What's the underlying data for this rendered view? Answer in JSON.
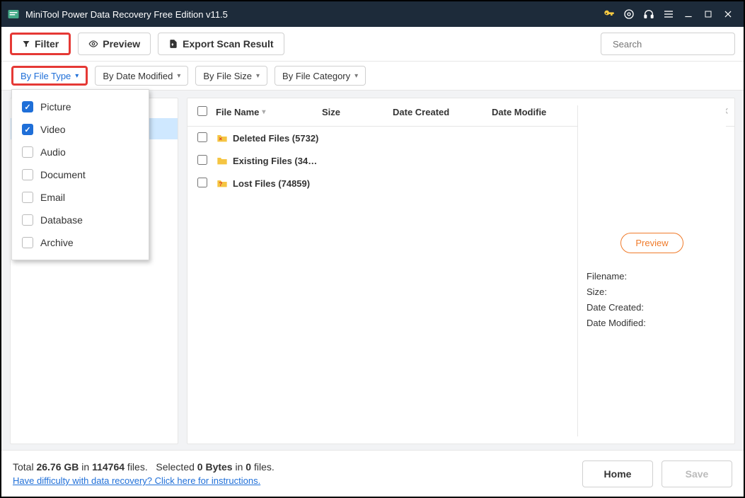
{
  "titlebar": {
    "title": "MiniTool Power Data Recovery Free Edition v11.5"
  },
  "toolbar": {
    "filter": "Filter",
    "preview": "Preview",
    "export": "Export Scan Result",
    "search_placeholder": "Search"
  },
  "filters": {
    "by_file_type": "By File Type",
    "by_date_modified": "By Date Modified",
    "by_file_size": "By File Size",
    "by_file_category": "By File Category"
  },
  "dropdown": {
    "items": [
      {
        "label": "Picture",
        "checked": true
      },
      {
        "label": "Video",
        "checked": true
      },
      {
        "label": "Audio",
        "checked": false
      },
      {
        "label": "Document",
        "checked": false
      },
      {
        "label": "Email",
        "checked": false
      },
      {
        "label": "Database",
        "checked": false
      },
      {
        "label": "Archive",
        "checked": false
      }
    ]
  },
  "table": {
    "headers": {
      "name": "File Name",
      "size": "Size",
      "date_created": "Date Created",
      "date_modified": "Date Modifie"
    },
    "rows": [
      {
        "label": "Deleted Files (5732)",
        "icon": "deleted"
      },
      {
        "label": "Existing Files (34…",
        "icon": "existing"
      },
      {
        "label": "Lost Files (74859)",
        "icon": "lost"
      }
    ]
  },
  "preview_panel": {
    "preview_btn": "Preview",
    "filename": "Filename:",
    "size": "Size:",
    "date_created": "Date Created:",
    "date_modified": "Date Modified:"
  },
  "footer": {
    "total_prefix": "Total ",
    "total_size": "26.76 GB",
    "total_in": " in ",
    "total_count": "114764",
    "total_suffix": " files.",
    "selected_prefix": "Selected ",
    "selected_size": "0 Bytes",
    "selected_in": " in ",
    "selected_count": "0",
    "selected_suffix": " files.",
    "help": "Have difficulty with data recovery? Click here for instructions.",
    "home": "Home",
    "save": "Save"
  }
}
